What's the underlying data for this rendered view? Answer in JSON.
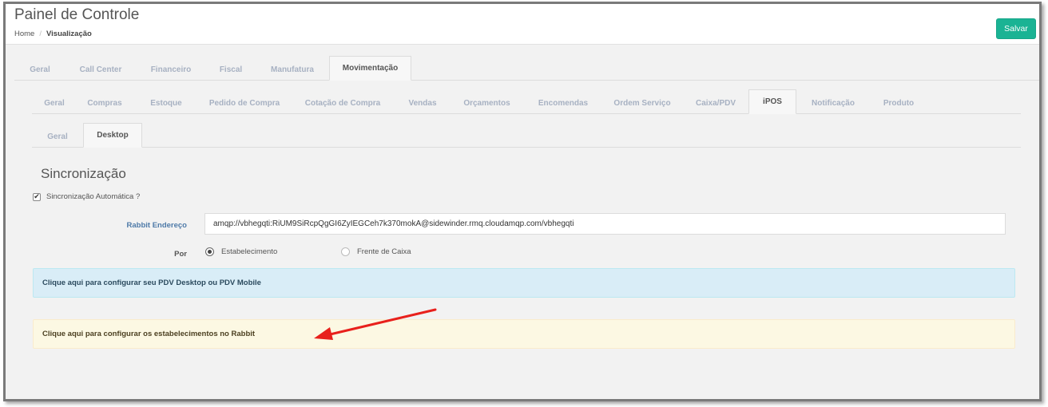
{
  "header": {
    "title": "Painel de Controle",
    "breadcrumb": {
      "home": "Home",
      "separator": "/",
      "current": "Visualização"
    },
    "save_label": "Salvar"
  },
  "tabs_level1": [
    {
      "label": "Geral",
      "active": false
    },
    {
      "label": "Call Center",
      "active": false
    },
    {
      "label": "Financeiro",
      "active": false
    },
    {
      "label": "Fiscal",
      "active": false
    },
    {
      "label": "Manufatura",
      "active": false
    },
    {
      "label": "Movimentação",
      "active": true
    }
  ],
  "tabs_level2": [
    {
      "label": "Geral",
      "active": false
    },
    {
      "label": "Compras",
      "active": false
    },
    {
      "label": "Estoque",
      "active": false
    },
    {
      "label": "Pedido de Compra",
      "active": false
    },
    {
      "label": "Cotação de Compra",
      "active": false
    },
    {
      "label": "Vendas",
      "active": false
    },
    {
      "label": "Orçamentos",
      "active": false
    },
    {
      "label": "Encomendas",
      "active": false
    },
    {
      "label": "Ordem Serviço",
      "active": false
    },
    {
      "label": "Caixa/PDV",
      "active": false
    },
    {
      "label": "iPOS",
      "active": true
    },
    {
      "label": "Notificação",
      "active": false
    },
    {
      "label": "Produto",
      "active": false
    }
  ],
  "tabs_level3": [
    {
      "label": "Geral",
      "active": false
    },
    {
      "label": "Desktop",
      "active": true
    }
  ],
  "form": {
    "section_title": "Sincronização",
    "auto_sync_label": "Sincronização Automática ?",
    "auto_sync_checked": true,
    "rabbit_label": "Rabbit Endereço",
    "rabbit_value": "amqp://vbhegqti:RiUM9SiRcpQgGI6ZyIEGCeh7k370mokA@sidewinder.rmq.cloudamqp.com/vbhegqti",
    "por_label": "Por",
    "radio_options": [
      {
        "label": "Estabelecimento",
        "checked": true
      },
      {
        "label": "Frente de Caixa",
        "checked": false
      }
    ]
  },
  "alerts": {
    "info": "Clique aqui para configurar seu PDV Desktop ou PDV Mobile",
    "warning": "Clique aqui para configurar os estabelecimentos no Rabbit"
  },
  "annotation": {
    "arrow_color": "#e8201c"
  },
  "colors": {
    "save_button": "#1ab394",
    "tab_inactive_text": "#a7b1c2",
    "info_bg": "#d9edf7",
    "warning_bg": "#fcf8e3"
  }
}
